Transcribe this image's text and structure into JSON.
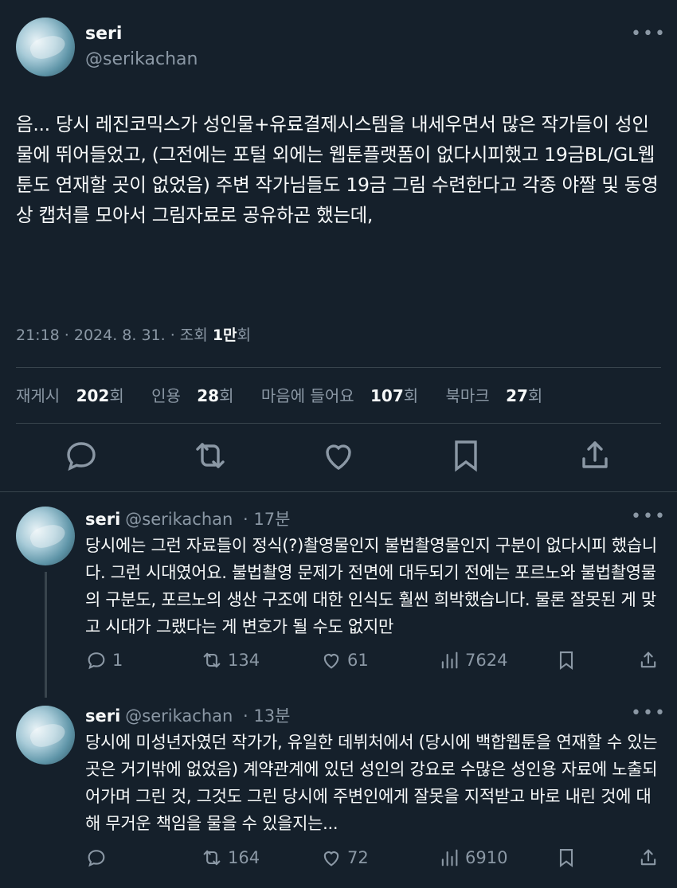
{
  "main_tweet": {
    "name": "seri",
    "handle": "@serikachan",
    "text": "음... 당시 레진코믹스가 성인물+유료결제시스템을 내세우면서 많은 작가들이 성인물에 뛰어들었고, (그전에는 포털 외에는 웹툰플랫폼이 없다시피했고 19금BL/GL웹툰도 연재할 곳이 없었음) 주변 작가님들도 19금 그림 수련한다고 각종 야짤 및 동영상 캡처를 모아서 그림자료로 공유하곤 했는데,",
    "time": "21:18 · 2024. 8. 31. · 조회",
    "views": "1만",
    "views_suffix": "회",
    "stats": {
      "retweets_label": "재게시",
      "retweets": "202",
      "retweets_unit": "회",
      "quotes_label": "인용",
      "quotes": "28",
      "quotes_unit": "회",
      "likes_label": "마음에 들어요",
      "likes": "107",
      "likes_unit": "회",
      "bookmarks_label": "북마크",
      "bookmarks": "27",
      "bookmarks_unit": "회"
    },
    "actions": [
      "reply-icon",
      "retweet-icon",
      "like-icon",
      "bookmark-icon",
      "share-icon"
    ]
  },
  "replies": [
    {
      "name": "seri",
      "handle": "@serikachan",
      "time": "17분",
      "text": "당시에는 그런 자료들이 정식(?)촬영물인지 불법촬영물인지 구분이 없다시피 했습니다. 그런 시대였어요. 불법촬영 문제가 전면에 대두되기 전에는 포르노와 불법촬영물의 구분도, 포르노의 생산 구조에 대한 인식도 훨씬 희박했습니다. 물론 잘못된 게 맞고 시대가 그랬다는 게 변호가 될 수도 없지만",
      "replies": "1",
      "retweets": "134",
      "likes": "61",
      "views": "7624"
    },
    {
      "name": "seri",
      "handle": "@serikachan",
      "time": "13분",
      "text": "당시에 미성년자였던 작가가, 유일한 데뷔처에서 (당시에 백합웹툰을 연재할 수 있는 곳은 거기밖에 없었음) 계약관계에 있던 성인의 강요로 수많은 성인용 자료에 노출되어가며 그린 것, 그것도 그린 당시에 주변인에게 잘못을 지적받고 바로 내린 것에 대해 무거운 책임을 물을 수 있을지는...",
      "replies": "",
      "retweets": "164",
      "likes": "72",
      "views": "6910"
    }
  ],
  "colors": {
    "background": "#15202b",
    "text": "#f7f9f9",
    "muted": "#8b98a5",
    "divider": "#38444d"
  }
}
